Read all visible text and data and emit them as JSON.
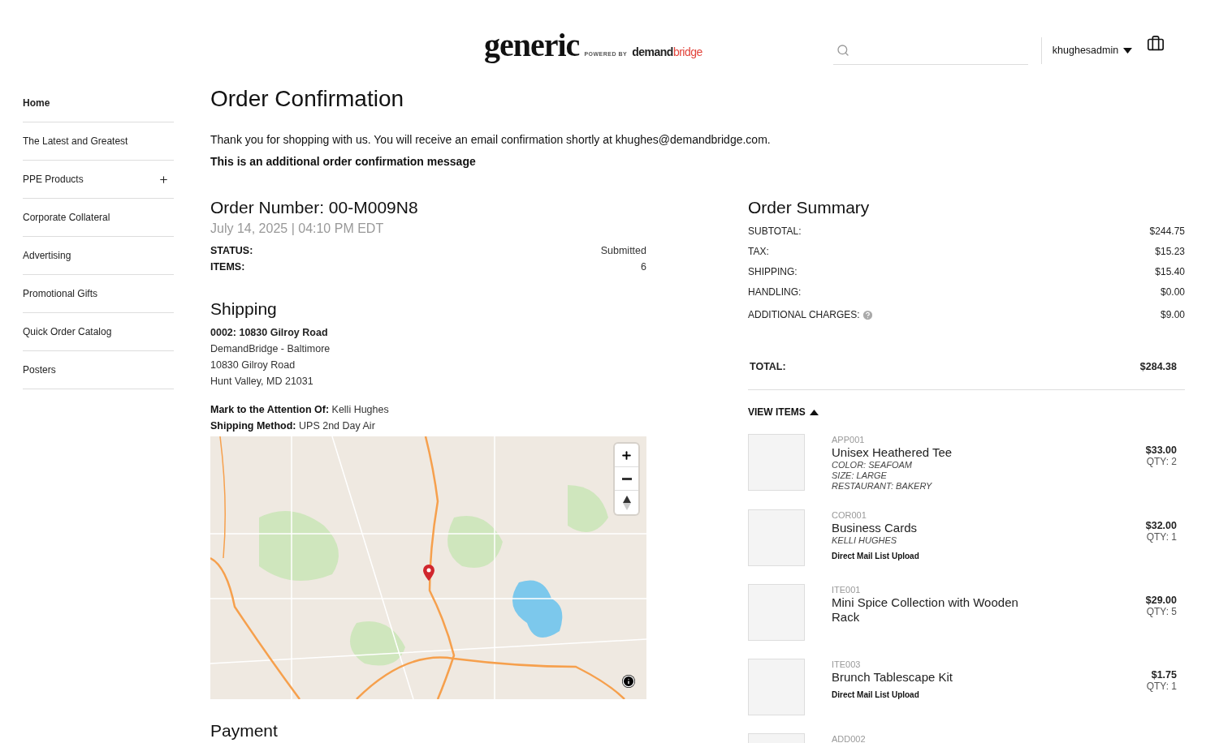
{
  "header": {
    "logo": {
      "brand": "generic",
      "powered_by": "POWERED BY",
      "partner": [
        "demand",
        "bridge"
      ]
    },
    "user": "khughesadmin"
  },
  "sidebar": {
    "items": [
      {
        "label": "Home",
        "selected": true,
        "expandable": false
      },
      {
        "label": "The Latest and Greatest",
        "selected": false,
        "expandable": false
      },
      {
        "label": "PPE Products",
        "selected": false,
        "expandable": true
      },
      {
        "label": "Corporate Collateral",
        "selected": false,
        "expandable": false
      },
      {
        "label": "Advertising",
        "selected": false,
        "expandable": false
      },
      {
        "label": "Promotional Gifts",
        "selected": false,
        "expandable": false
      },
      {
        "label": "Quick Order Catalog",
        "selected": false,
        "expandable": false
      },
      {
        "label": "Posters",
        "selected": false,
        "expandable": false
      }
    ]
  },
  "page": {
    "title": "Order Confirmation",
    "thank_you": "Thank you for shopping with us. You will receive an email confirmation shortly at khughes@demandbridge.com.",
    "additional_message": "This is an additional order confirmation message"
  },
  "order": {
    "number": "Order Number: 00-M009N8",
    "date": "July 14, 2025 | 04:10 PM EDT",
    "fields": [
      {
        "label": "STATUS:",
        "value": "Submitted"
      },
      {
        "label": "ITEMS:",
        "value": "6"
      }
    ]
  },
  "shipping": {
    "title": "Shipping",
    "address_name": "0002: 10830 Gilroy Road",
    "address_lines": [
      "DemandBridge - Baltimore",
      "10830 Gilroy Road",
      "Hunt Valley, MD 21031"
    ],
    "details": [
      {
        "label": "Mark to the Attention Of:",
        "value": "Kelli Hughes"
      },
      {
        "label": "Shipping Method:",
        "value": "UPS 2nd Day Air"
      }
    ]
  },
  "payment": {
    "title": "Payment"
  },
  "summary": {
    "title": "Order Summary",
    "rows": [
      {
        "label": "SUBTOTAL:",
        "value": "$244.75",
        "help": false
      },
      {
        "label": "TAX:",
        "value": "$15.23",
        "help": false
      },
      {
        "label": "SHIPPING:",
        "value": "$15.40",
        "help": false
      },
      {
        "label": "HANDLING:",
        "value": "$0.00",
        "help": false
      },
      {
        "label": "ADDITIONAL CHARGES:",
        "value": "$9.00",
        "help": true
      }
    ],
    "total": {
      "label": "TOTAL:",
      "value": "$284.38"
    },
    "view_items": {
      "label": "VIEW ITEMS",
      "expanded": true
    },
    "items": [
      {
        "sku": "APP001",
        "name": "Unisex Heathered Tee",
        "options": [
          "COLOR: SEAFOAM",
          "SIZE: LARGE",
          "RESTAURANT: BAKERY"
        ],
        "price": "$33.00",
        "qty": "QTY: 2"
      },
      {
        "sku": "COR001",
        "name": "Business Cards",
        "options": [
          "KELLI HUGHES"
        ],
        "note": "Direct Mail List Upload",
        "price": "$32.00",
        "qty": "QTY: 1"
      },
      {
        "sku": "ITE001",
        "name": "Mini Spice Collection with Wooden Rack",
        "price": "$29.00",
        "qty": "QTY: 5"
      },
      {
        "sku": "ITE003",
        "name": "Brunch Tablescape Kit",
        "note": "Direct Mail List Upload",
        "price": "$1.75",
        "qty": "QTY: 1"
      },
      {
        "sku": "ADD002"
      }
    ]
  }
}
